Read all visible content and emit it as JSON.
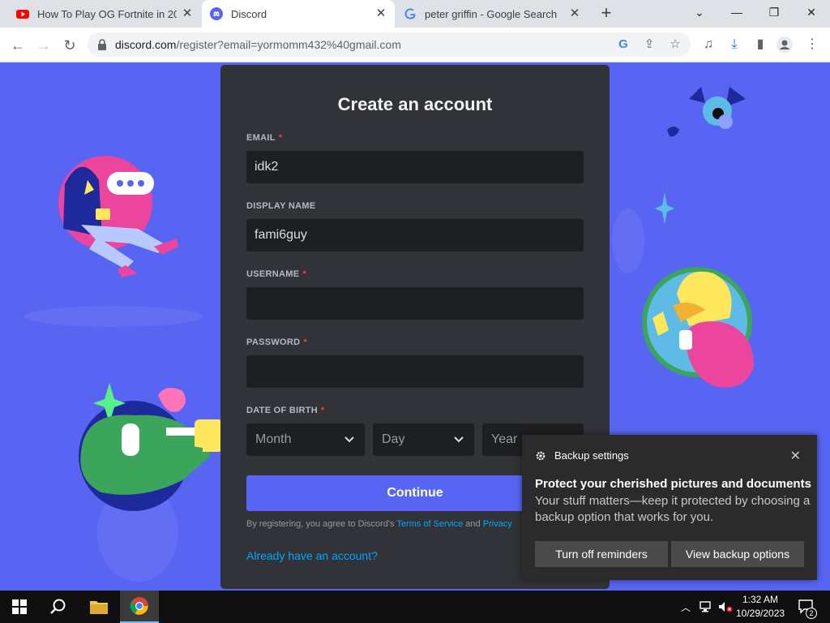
{
  "browser": {
    "tabs": [
      {
        "title": "How To Play OG Fortnite in 2023",
        "favicon": "youtube-icon"
      },
      {
        "title": "Discord",
        "favicon": "discord-icon",
        "active": true
      },
      {
        "title": "peter griffin - Google Search",
        "favicon": "google-icon"
      }
    ],
    "new_tab_symbol": "+",
    "address": {
      "host": "discord.com",
      "path": "/register?email=yormomm432%40gmail.com"
    }
  },
  "form": {
    "title": "Create an account",
    "email": {
      "label": "EMAIL",
      "required": "*",
      "value": "idk2"
    },
    "display_name": {
      "label": "DISPLAY NAME",
      "value": "fami6guy"
    },
    "username": {
      "label": "USERNAME",
      "required": "*",
      "value": ""
    },
    "password": {
      "label": "PASSWORD",
      "required": "*",
      "value": ""
    },
    "dob": {
      "label": "DATE OF BIRTH",
      "required": "*",
      "month": "Month",
      "day": "Day",
      "year": "Year"
    },
    "continue_label": "Continue",
    "legal_prefix": "By registering, you agree to Discord's ",
    "terms_label": "Terms of Service",
    "legal_and": " and ",
    "privacy_label": "Privacy",
    "login_link": "Already have an account?"
  },
  "notification": {
    "app": "Backup settings",
    "title": "Protect your cherished pictures and documents",
    "body": "Your stuff matters—keep it protected by choosing a backup option that works for you.",
    "button_left": "Turn off reminders",
    "button_right": "View backup options"
  },
  "taskbar": {
    "time": "1:32 AM",
    "date": "10/29/2023",
    "notification_count": "2"
  },
  "colors": {
    "discord_blurple": "#5865f2",
    "card_bg": "#313338",
    "input_bg": "#1e1f22",
    "link": "#00a8fc",
    "required": "#f23f42"
  }
}
